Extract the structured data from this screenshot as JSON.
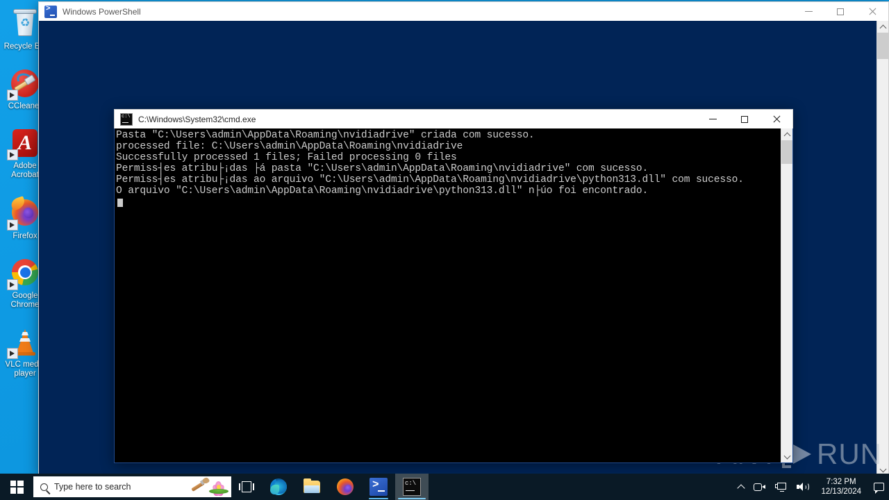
{
  "desktop": {
    "icons": [
      {
        "name": "recycle-bin",
        "label": "Recycle Bin"
      },
      {
        "name": "ccleaner",
        "label": "CCleaner"
      },
      {
        "name": "adobe-acrobat",
        "label": "Adobe Acrobat"
      },
      {
        "name": "firefox",
        "label": "Firefox"
      },
      {
        "name": "google-chrome",
        "label": "Google Chrome"
      },
      {
        "name": "vlc",
        "label": "VLC media player"
      }
    ]
  },
  "powershell_window": {
    "title": "Windows PowerShell",
    "icon": "powershell-icon",
    "minimize_label": "Minimize",
    "maximize_label": "Maximize",
    "close_label": "Close",
    "console_text": "",
    "background_color": "#012456",
    "active": false
  },
  "cmd_window": {
    "title": "C:\\Windows\\System32\\cmd.exe",
    "icon": "cmd-icon",
    "minimize_label": "Minimize",
    "maximize_label": "Maximize",
    "close_label": "Close",
    "background_color": "#000000",
    "foreground_color": "#cccccc",
    "active": true,
    "lines": [
      "Pasta \"C:\\Users\\admin\\AppData\\Roaming\\nvidiadrive\" criada com sucesso.",
      "processed file: C:\\Users\\admin\\AppData\\Roaming\\nvidiadrive",
      "Successfully processed 1 files; Failed processing 0 files",
      "Permiss┤es atribu├¡das ├á pasta \"C:\\Users\\admin\\AppData\\Roaming\\nvidiadrive\" com sucesso.",
      "Permiss┤es atribu├¡das ao arquivo \"C:\\Users\\admin\\AppData\\Roaming\\nvidiadrive\\python313.dll\" com sucesso.",
      "O arquivo \"C:\\Users\\admin\\AppData\\Roaming\\nvidiadrive\\python313.dll\" n├úo foi encontrado."
    ]
  },
  "watermark": {
    "text_left": "ANY",
    "text_right": "RUN",
    "logo": "anyrun-play-logo"
  },
  "taskbar": {
    "start_label": "Start",
    "search": {
      "placeholder": "Type here to search",
      "icon": "search-icon"
    },
    "cortana_icon": "cortana-lotus-brush-icon",
    "taskview_label": "Task View",
    "apps": [
      {
        "name": "edge",
        "label": "Microsoft Edge",
        "state": "pinned"
      },
      {
        "name": "file-explorer",
        "label": "File Explorer",
        "state": "pinned"
      },
      {
        "name": "firefox",
        "label": "Firefox",
        "state": "pinned"
      },
      {
        "name": "powershell",
        "label": "Windows PowerShell",
        "state": "running"
      },
      {
        "name": "cmd",
        "label": "C:\\Windows\\System32\\cmd.exe",
        "state": "active"
      }
    ],
    "tray": {
      "show_hidden_label": "Show hidden icons",
      "camera_label": "Camera / screen recording",
      "network_label": "Network",
      "volume_label": "Speakers",
      "time": "7:32 PM",
      "date": "12/13/2024",
      "notifications_label": "Notifications"
    }
  }
}
